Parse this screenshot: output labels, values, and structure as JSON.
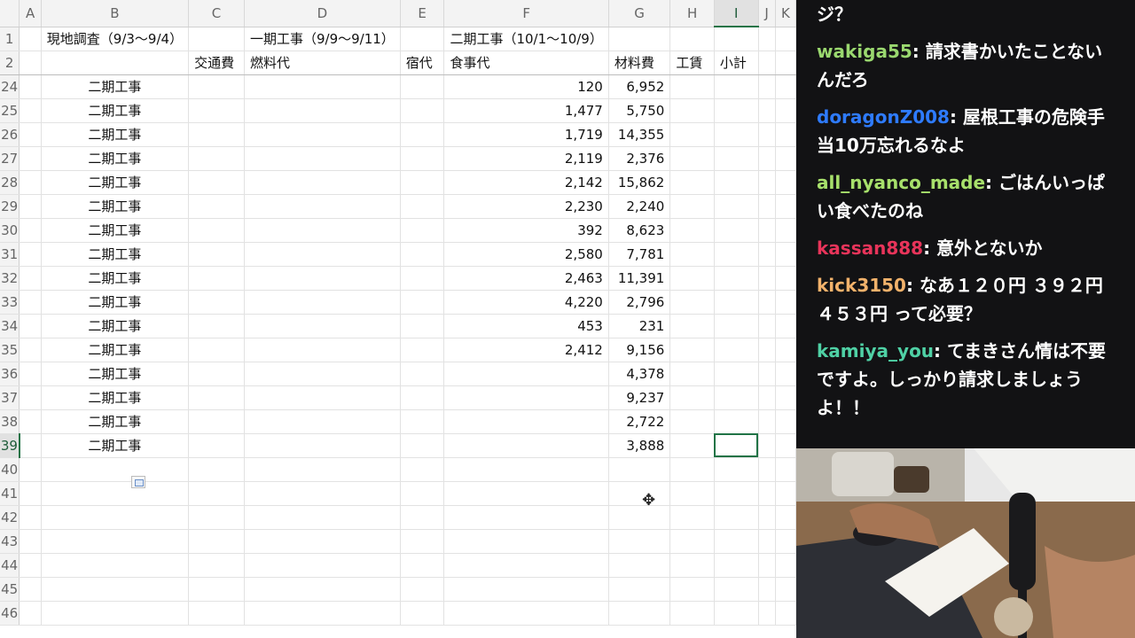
{
  "spreadsheet": {
    "columns": [
      "",
      "A",
      "B",
      "C",
      "D",
      "E",
      "F",
      "G",
      "H",
      "I",
      "J",
      "K"
    ],
    "selected_column": "I",
    "header_row1": {
      "row": "1",
      "B": "現地調査（9/3〜9/4）",
      "D": "一期工事（9/9〜9/11）",
      "F": "二期工事（10/1〜10/9）"
    },
    "header_row2": {
      "row": "2",
      "C": "交通費",
      "D": "燃料代",
      "E": "宿代",
      "F": "食事代",
      "G": "材料費",
      "H": "工賃",
      "I": "小計"
    },
    "rows": [
      {
        "row": "24",
        "B": "二期工事",
        "F": "120",
        "G": "6,952"
      },
      {
        "row": "25",
        "B": "二期工事",
        "F": "1,477",
        "G": "5,750"
      },
      {
        "row": "26",
        "B": "二期工事",
        "F": "1,719",
        "G": "14,355"
      },
      {
        "row": "27",
        "B": "二期工事",
        "F": "2,119",
        "G": "2,376"
      },
      {
        "row": "28",
        "B": "二期工事",
        "F": "2,142",
        "G": "15,862"
      },
      {
        "row": "29",
        "B": "二期工事",
        "F": "2,230",
        "G": "2,240"
      },
      {
        "row": "30",
        "B": "二期工事",
        "F": "392",
        "G": "8,623"
      },
      {
        "row": "31",
        "B": "二期工事",
        "F": "2,580",
        "G": "7,781"
      },
      {
        "row": "32",
        "B": "二期工事",
        "F": "2,463",
        "G": "11,391"
      },
      {
        "row": "33",
        "B": "二期工事",
        "F": "4,220",
        "G": "2,796"
      },
      {
        "row": "34",
        "B": "二期工事",
        "F": "453",
        "G": "231"
      },
      {
        "row": "35",
        "B": "二期工事",
        "F": "2,412",
        "G": "9,156"
      },
      {
        "row": "36",
        "B": "二期工事",
        "F": "",
        "G": "4,378"
      },
      {
        "row": "37",
        "B": "二期工事",
        "F": "",
        "G": "9,237"
      },
      {
        "row": "38",
        "B": "二期工事",
        "F": "",
        "G": "2,722"
      },
      {
        "row": "39",
        "B": "二期工事",
        "F": "",
        "G": "3,888"
      }
    ],
    "empty_rows": [
      "40",
      "41",
      "42",
      "43",
      "44",
      "45",
      "46"
    ],
    "selected_row": "39"
  },
  "chat": {
    "messages": [
      {
        "user": "",
        "text": "ジ？",
        "color": "#ffffff"
      },
      {
        "user": "wakiga55",
        "text": ": 請求書かいたことないんだろ",
        "color": "#9ad86f"
      },
      {
        "user": "doragonZ008",
        "text": ": 屋根工事の危険手当10万忘れるなよ",
        "color": "#2e7bff"
      },
      {
        "user": "all_nyanco_made",
        "text": ": ごはんいっぱい食べたのね",
        "color": "#a7e06b"
      },
      {
        "user": "kassan888",
        "text": ": 意外とないか",
        "color": "#e8345a"
      },
      {
        "user": "kick3150",
        "text": ": なあ１２０円 ３９２円 ４５３円 って必要？",
        "color": "#f2b26b"
      },
      {
        "user": "kamiya_you",
        "text": ": てまきさん情は不要ですよ。しっかり請求しましょうよ！！",
        "color": "#4fd1a5"
      }
    ]
  },
  "colors": {
    "excel_green": "#217346",
    "chat_bg": "#121214"
  }
}
